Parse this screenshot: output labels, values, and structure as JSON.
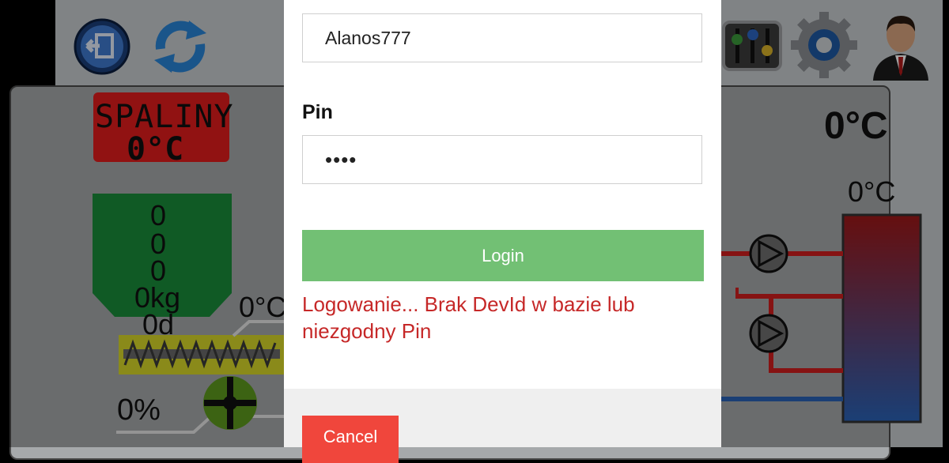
{
  "dialog": {
    "username_value": "Alanos777",
    "pin_label": "Pin",
    "pin_value": "••••",
    "login_label": "Login",
    "error_message": "Logowanie... Brak DevId w bazie lub niezgodny Pin",
    "cancel_label": "Cancel"
  },
  "background_app": {
    "spaliny_title": "SPALINY",
    "spaliny_temp": "0°C",
    "hopper_values": [
      "0",
      "0",
      "0",
      "0kg",
      "0d"
    ],
    "feeder_temp": "0°C",
    "percent": "0%",
    "boiler_temp_top": "0°C",
    "tank_temp": "0°C",
    "icons": [
      "exit-icon",
      "refresh-icon",
      "sliders-icon",
      "gear-icon",
      "user-icon"
    ]
  },
  "colors": {
    "login_green": "#72c074",
    "cancel_red": "#f0463c",
    "error_red": "#c62828",
    "spaliny_red": "#e31d1d",
    "hopper_green": "#1a8d3a"
  }
}
